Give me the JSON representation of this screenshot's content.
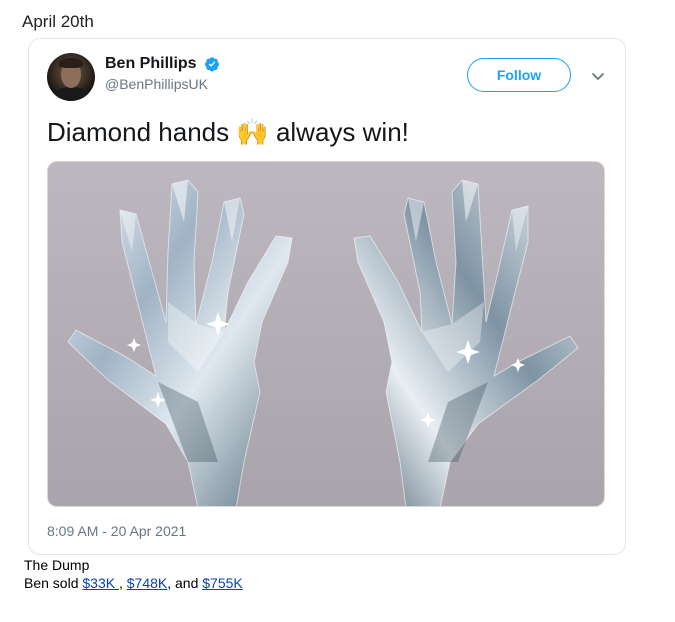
{
  "section": {
    "date_heading": "April 20th"
  },
  "tweet": {
    "author": {
      "display_name": "Ben Phillips",
      "handle": "@BenPhillipsUK",
      "verified": true
    },
    "follow_label": "Follow",
    "text_before_emoji": "Diamond hands ",
    "emoji": "🙌",
    "text_after_emoji": " always win!",
    "media": {
      "kind": "image",
      "subject": "diamond-hands"
    },
    "timestamp": "8:09 AM - 20 Apr 2021"
  },
  "summary": {
    "title": "The Dump",
    "prefix": "Ben sold ",
    "links": [
      "$33K ",
      "$748K",
      "$755K"
    ],
    "sep1": ", ",
    "sep2": ", and "
  },
  "colors": {
    "accent": "#1da1f2",
    "link": "#0645ad",
    "muted": "#657786"
  },
  "icons": {
    "verified": "verified-badge-icon",
    "more": "chevron-down-icon"
  }
}
